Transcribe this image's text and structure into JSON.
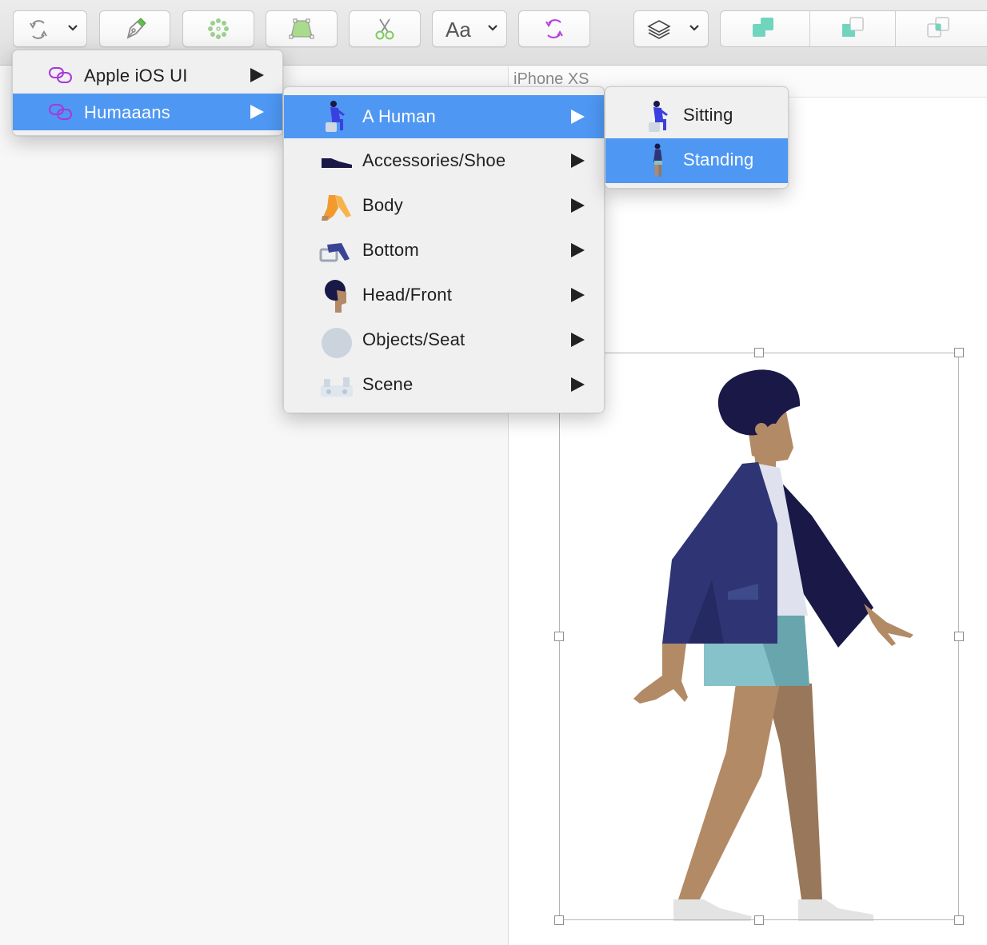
{
  "toolbar": {
    "font_button_label": "Aa"
  },
  "artboard": {
    "title": "iPhone XS"
  },
  "menu_level1": {
    "items": [
      {
        "label": "Apple iOS UI",
        "icon": "link-icon",
        "has_submenu": true
      },
      {
        "label": "Humaaans",
        "icon": "link-icon",
        "has_submenu": true,
        "highlighted": true
      }
    ]
  },
  "menu_level2": {
    "items": [
      {
        "label": "A Human",
        "icon": "sitting-human-icon",
        "has_submenu": true,
        "highlighted": true
      },
      {
        "label": "Accessories/Shoe",
        "icon": "shoe-icon",
        "has_submenu": true
      },
      {
        "label": "Body",
        "icon": "body-icon",
        "has_submenu": true
      },
      {
        "label": "Bottom",
        "icon": "bottom-icon",
        "has_submenu": true
      },
      {
        "label": "Head/Front",
        "icon": "head-icon",
        "has_submenu": true
      },
      {
        "label": "Objects/Seat",
        "icon": "seat-icon",
        "has_submenu": true
      },
      {
        "label": "Scene",
        "icon": "scene-icon",
        "has_submenu": true
      }
    ]
  },
  "menu_level3": {
    "items": [
      {
        "label": "Sitting",
        "icon": "sitting-human-icon"
      },
      {
        "label": "Standing",
        "icon": "standing-human-icon",
        "highlighted": true
      }
    ]
  },
  "colors": {
    "menu_highlight": "#4e97f3",
    "link_icon": "#a838d8",
    "symbol_accent": "#6fd6bd",
    "figure_hair": "#1a1847",
    "figure_skin": "#b28a65",
    "figure_jacket": "#2f3574",
    "figure_shorts": "#86c2ca"
  }
}
